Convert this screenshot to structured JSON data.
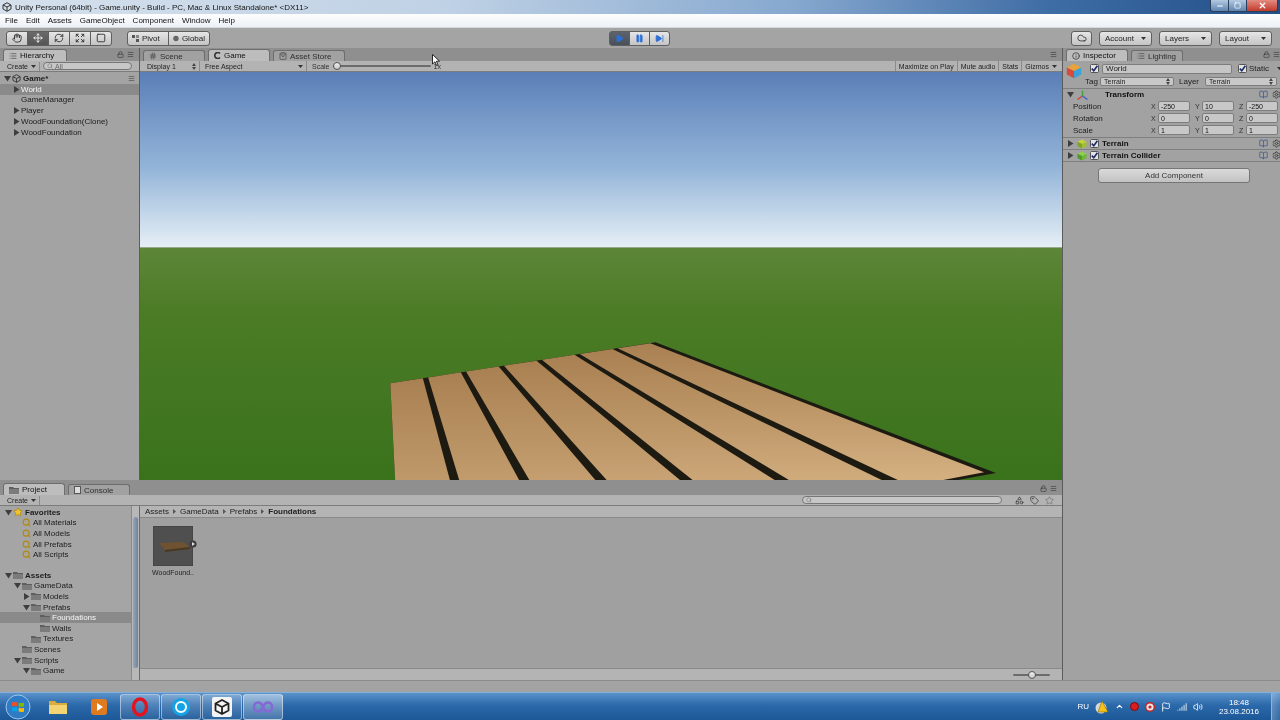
{
  "window": {
    "title": "Unity Personal (64bit) - Game.unity - Build - PC, Mac & Linux Standalone* <DX11>"
  },
  "menu": [
    "File",
    "Edit",
    "Assets",
    "GameObject",
    "Component",
    "Window",
    "Help"
  ],
  "toolbar": {
    "tools": [
      {
        "kind": "hand",
        "selected": false
      },
      {
        "kind": "move",
        "selected": true
      },
      {
        "kind": "rotate",
        "selected": false
      },
      {
        "kind": "scale",
        "selected": false
      },
      {
        "kind": "rect",
        "selected": false
      }
    ],
    "pivot": "Pivot",
    "space": "Global",
    "playback": [
      {
        "kind": "play",
        "selected": true
      },
      {
        "kind": "pause",
        "selected": false
      },
      {
        "kind": "step",
        "selected": false
      }
    ],
    "account": "Account",
    "layers": "Layers",
    "layout": "Layout"
  },
  "hierarchy": {
    "tab": "Hierarchy",
    "create": "Create",
    "search": {
      "placeholder": "All"
    },
    "scene": {
      "label": "Game*",
      "expanded": true,
      "children": [
        {
          "label": "World",
          "selected": true,
          "expanded": false
        },
        {
          "label": "GameManager",
          "selected": false
        },
        {
          "label": "Player",
          "selected": false,
          "expanded": false
        },
        {
          "label": "WoodFoundation(Clone)",
          "selected": false,
          "expanded": false
        },
        {
          "label": "WoodFoundation",
          "selected": false,
          "expanded": false
        }
      ]
    }
  },
  "game_view": {
    "tabs": [
      {
        "kind": "scene",
        "label": "Scene",
        "selected": false
      },
      {
        "kind": "game",
        "label": "Game",
        "selected": true
      },
      {
        "kind": "store",
        "label": "Asset Store",
        "selected": false
      }
    ],
    "display": "Display 1",
    "aspect": "Free Aspect",
    "scale": {
      "label": "Scale",
      "level": 0,
      "reading": "1x"
    },
    "buttons": [
      {
        "kind": "toggle",
        "label": "Maximize on Play"
      },
      {
        "kind": "toggle",
        "label": "Mute audio"
      },
      {
        "kind": "toggle",
        "label": "Stats"
      },
      {
        "kind": "menu",
        "label": "Gizmos"
      }
    ]
  },
  "inspector": {
    "tabs": [
      {
        "kind": "inspector",
        "label": "Inspector",
        "selected": true
      },
      {
        "kind": "lighting",
        "label": "Lighting",
        "selected": false
      }
    ],
    "object": {
      "active": true,
      "name": "World",
      "static": true,
      "static_label": "Static",
      "tag_label": "Tag",
      "tag": "Terrain",
      "layer_label": "Layer",
      "layer": "Terrain"
    },
    "components": [
      {
        "kind": "transform",
        "name": "Transform",
        "expanded": true,
        "rows": [
          {
            "label": "Position",
            "values": [
              {
                "axis": "X",
                "value": "-250"
              },
              {
                "axis": "Y",
                "value": "10"
              },
              {
                "axis": "Z",
                "value": "-250"
              }
            ]
          },
          {
            "label": "Rotation",
            "values": [
              {
                "axis": "X",
                "value": "0"
              },
              {
                "axis": "Y",
                "value": "0"
              },
              {
                "axis": "Z",
                "value": "0"
              }
            ]
          },
          {
            "label": "Scale",
            "values": [
              {
                "axis": "X",
                "value": "1"
              },
              {
                "axis": "Y",
                "value": "1"
              },
              {
                "axis": "Z",
                "value": "1"
              }
            ]
          }
        ]
      },
      {
        "kind": "terrain",
        "name": "Terrain",
        "expanded": false,
        "enabled": true
      },
      {
        "kind": "collider",
        "name": "Terrain Collider",
        "expanded": false,
        "enabled": true
      }
    ],
    "add_button": "Add Component"
  },
  "project": {
    "tabs": [
      {
        "kind": "project",
        "label": "Project",
        "selected": true
      },
      {
        "kind": "console",
        "label": "Console",
        "selected": false
      }
    ],
    "create": "Create",
    "tree": [
      {
        "kind": "favorites",
        "label": "Favorites",
        "selected": false,
        "expanded": true,
        "children": [
          {
            "kind": "search",
            "label": "All Materials",
            "selected": false
          },
          {
            "kind": "search",
            "label": "All Models",
            "selected": false
          },
          {
            "kind": "search",
            "label": "All Prefabs",
            "selected": false
          },
          {
            "kind": "search",
            "label": "All Scripts",
            "selected": false
          }
        ]
      },
      {
        "kind": "folder",
        "label": "Assets",
        "selected": false,
        "expanded": true,
        "children": [
          {
            "kind": "folder",
            "label": "GameData",
            "selected": false,
            "expanded": true,
            "children": [
              {
                "kind": "folder",
                "label": "Models",
                "selected": false,
                "expanded": false
              },
              {
                "kind": "folder",
                "label": "Prefabs",
                "selected": false,
                "expanded": true,
                "children": [
                  {
                    "kind": "folder",
                    "label": "Foundations",
                    "selected": true
                  },
                  {
                    "kind": "folder",
                    "label": "Walls",
                    "selected": false
                  }
                ]
              },
              {
                "kind": "folder",
                "label": "Textures",
                "selected": false
              }
            ]
          },
          {
            "kind": "folder",
            "label": "Scenes",
            "selected": false
          },
          {
            "kind": "folder",
            "label": "Scripts",
            "selected": false,
            "expanded": true,
            "children": [
              {
                "kind": "folder",
                "label": "Game",
                "selected": false,
                "expanded": true
              }
            ]
          }
        ]
      }
    ],
    "breadcrumb": [
      "Assets",
      "GameData",
      "Prefabs",
      "Foundations"
    ],
    "assets": [
      {
        "label": "WoodFound.."
      }
    ],
    "icon_size": {
      "level": 0.5
    }
  },
  "taskbar": {
    "apps": [
      {
        "kind": "explorer",
        "running": false,
        "active": false
      },
      {
        "kind": "media",
        "running": false,
        "active": false
      },
      {
        "kind": "opera",
        "running": true,
        "active": false
      },
      {
        "kind": "skype",
        "running": true,
        "active": false
      },
      {
        "kind": "unity",
        "running": true,
        "active": false
      },
      {
        "kind": "vs",
        "running": true,
        "active": true
      }
    ],
    "language": "RU",
    "time": "18:48",
    "date": "23.08.2016"
  }
}
